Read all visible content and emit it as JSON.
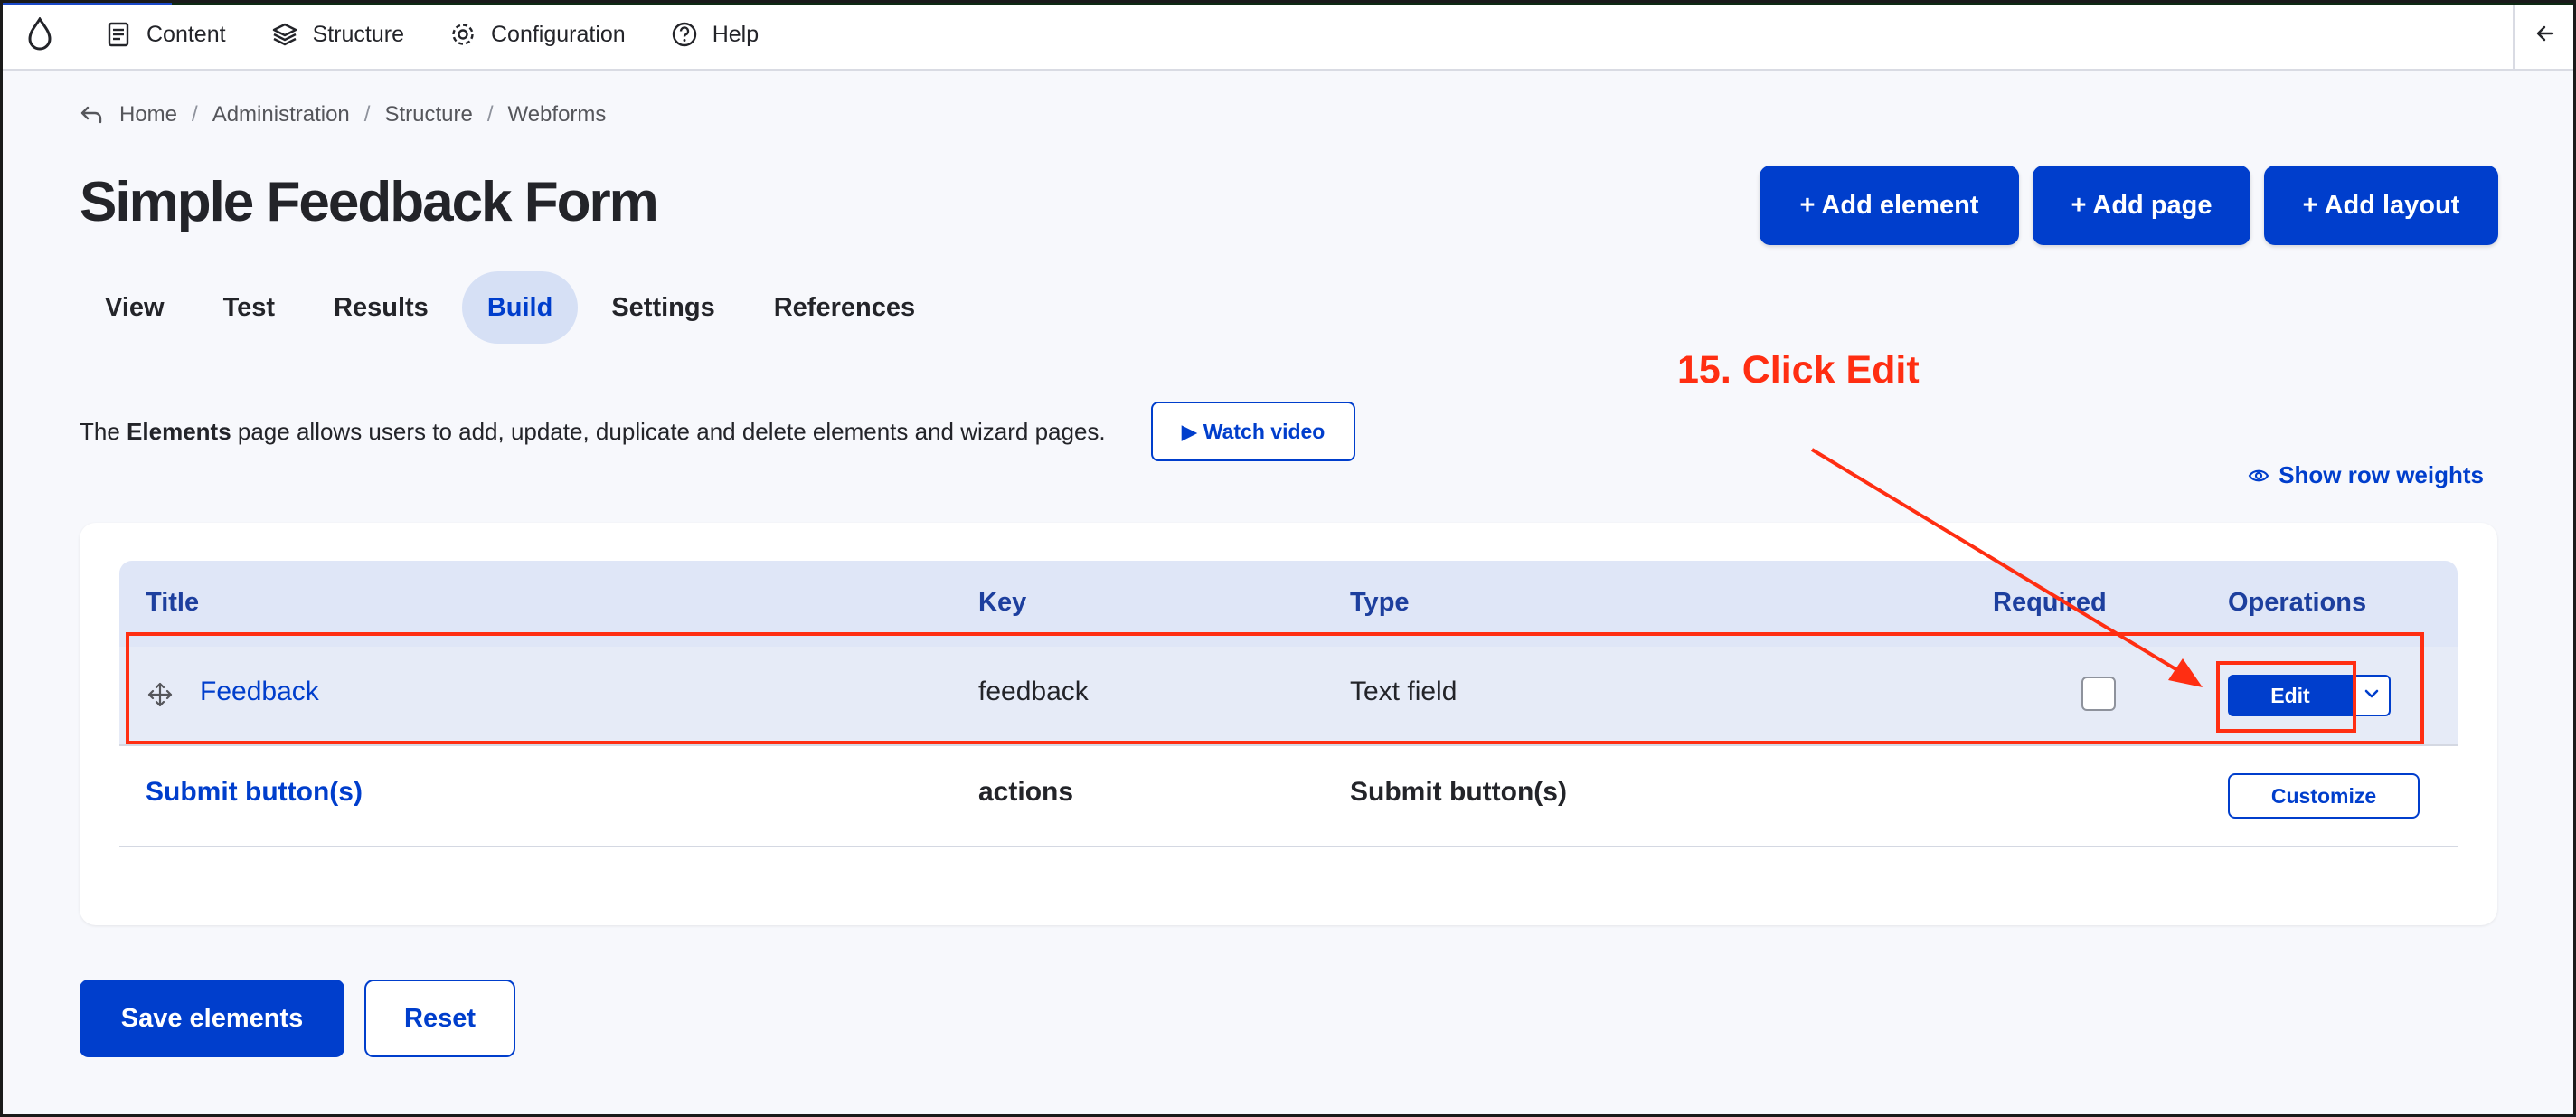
{
  "toolbar": {
    "items": [
      {
        "label": "Content",
        "icon": "document-icon"
      },
      {
        "label": "Structure",
        "icon": "layers-icon"
      },
      {
        "label": "Configuration",
        "icon": "gear-icon"
      },
      {
        "label": "Help",
        "icon": "help-circle-icon"
      }
    ]
  },
  "breadcrumb": {
    "items": [
      "Home",
      "Administration",
      "Structure",
      "Webforms"
    ],
    "separator": "/"
  },
  "page": {
    "title": "Simple Feedback Form"
  },
  "actions": {
    "add_element": "+ Add element",
    "add_page": "+ Add page",
    "add_layout": "+ Add layout"
  },
  "tabs": [
    {
      "label": "View",
      "active": false
    },
    {
      "label": "Test",
      "active": false
    },
    {
      "label": "Results",
      "active": false
    },
    {
      "label": "Build",
      "active": true
    },
    {
      "label": "Settings",
      "active": false
    },
    {
      "label": "References",
      "active": false
    }
  ],
  "intro": {
    "prefix": "The",
    "bold": "Elements",
    "suffix": "page allows users to add, update, duplicate and delete elements and wizard pages.",
    "watch_video": "▶ Watch video"
  },
  "show_row_weights": "Show row weights",
  "annotation": {
    "text": "15. Click Edit",
    "color": "#ff2e12"
  },
  "table": {
    "headers": {
      "title": "Title",
      "key": "Key",
      "type": "Type",
      "required": "Required",
      "operations": "Operations"
    },
    "rows": [
      {
        "title": "Feedback",
        "key": "feedback",
        "type": "Text field",
        "required": false,
        "operation": "Edit"
      },
      {
        "title": "Submit button(s)",
        "key": "actions",
        "type": "Submit button(s)",
        "operation": "Customize"
      }
    ]
  },
  "footer": {
    "save": "Save elements",
    "reset": "Reset"
  },
  "colors": {
    "accent": "#003ecc",
    "annotation": "#ff2e12",
    "header_bg": "#dfe6f7"
  }
}
